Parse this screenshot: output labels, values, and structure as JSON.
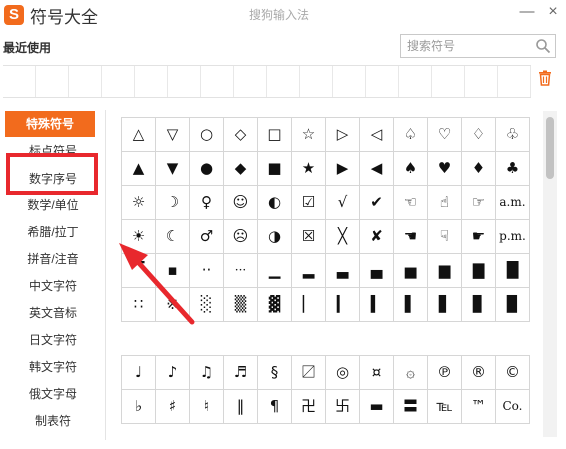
{
  "header": {
    "logo_text": "S",
    "title": "符号大全",
    "subtitle": "搜狗输入法",
    "minimize_glyph": "—",
    "close_glyph": "×"
  },
  "recent": {
    "label": "最近使用"
  },
  "search": {
    "placeholder": "搜索符号"
  },
  "sidebar": {
    "items": [
      {
        "label": "特殊符号",
        "active": true
      },
      {
        "label": "标点符号",
        "active": false
      },
      {
        "label": "数字序号",
        "active": false
      },
      {
        "label": "数学/单位",
        "active": false
      },
      {
        "label": "希腊/拉丁",
        "active": false
      },
      {
        "label": "拼音/注音",
        "active": false
      },
      {
        "label": "中文字符",
        "active": false
      },
      {
        "label": "英文音标",
        "active": false
      },
      {
        "label": "日文字符",
        "active": false
      },
      {
        "label": "韩文字符",
        "active": false
      },
      {
        "label": "俄文字母",
        "active": false
      },
      {
        "label": "制表符",
        "active": false
      }
    ]
  },
  "symbols_grid1": [
    [
      "△",
      "▽",
      "○",
      "◇",
      "□",
      "☆",
      "▷",
      "◁",
      "♤",
      "♡",
      "♢",
      "♧"
    ],
    [
      "▲",
      "▼",
      "●",
      "◆",
      "■",
      "★",
      "▶",
      "◀",
      "♠",
      "♥",
      "♦",
      "♣"
    ],
    [
      "☼",
      "☽",
      "♀",
      "☺",
      "◐",
      "☑",
      "√",
      "✔",
      "☜",
      "☝",
      "☞",
      "a.m."
    ],
    [
      "☀",
      "☾",
      "♂",
      "☹",
      "◑",
      "☒",
      "╳",
      "✘",
      "☚",
      "☟",
      "☛",
      "p.m."
    ],
    [
      "▔",
      "▪",
      "··",
      "···",
      "▁",
      "▂",
      "▃",
      "▄",
      "▅",
      "▆",
      "▇",
      "█"
    ],
    [
      "∷",
      "※",
      "░",
      "▒",
      "▓",
      "▏",
      "▎",
      "▍",
      "▌",
      "▋",
      "▊",
      "▉"
    ]
  ],
  "symbols_grid2": [
    [
      "♩",
      "♪",
      "♫",
      "♬",
      "§",
      "〼",
      "◎",
      "¤",
      "۞",
      "℗",
      "®",
      "©"
    ],
    [
      "♭",
      "♯",
      "♮",
      "‖",
      "¶",
      "卍",
      "卐",
      "▬",
      "〓",
      "℡",
      "™",
      "Co."
    ]
  ],
  "colors": {
    "accent": "#f26b1d",
    "highlight": "#e8282d",
    "trash": "#f26b1d"
  }
}
